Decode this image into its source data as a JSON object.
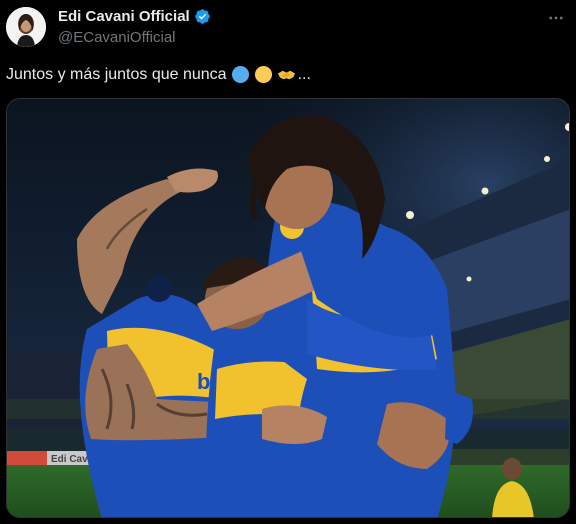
{
  "author": {
    "display_name": "Edi Cavani Official",
    "handle": "@ECavaniOfficial",
    "verified": true
  },
  "tweet": {
    "text": "Juntos y más juntos que nunca",
    "emojis": [
      "blue-circle",
      "yellow-circle",
      "handshake"
    ],
    "trailing": "..."
  },
  "menu": {
    "icon": "more-horizontal-icon"
  },
  "media": {
    "type": "photo",
    "jersey_sponsor": "be",
    "ad_board_text": "Edi Cavani",
    "colors": {
      "boca_blue": "#1d4fb8",
      "boca_yellow": "#f2c12e"
    }
  },
  "colors": {
    "background": "#000000",
    "text_primary": "#e7e9ea",
    "text_secondary": "#71767b",
    "verified_badge": "#1d9bf0"
  }
}
